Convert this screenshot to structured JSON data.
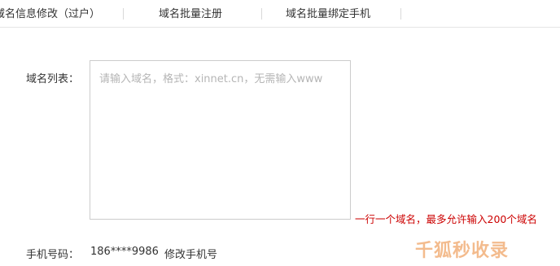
{
  "tabs": [
    {
      "label": "域名信息修改（过户）"
    },
    {
      "label": "域名批量注册"
    },
    {
      "label": "域名批量绑定手机"
    }
  ],
  "form": {
    "domain_list_label": "域名列表：",
    "domain_list_placeholder": "请输入域名，格式：xinnet.cn，无需输入www",
    "domain_list_hint": "一行一个域名，最多允许输入200个域名",
    "phone_label": "手机号码：",
    "phone_value": "186****9986",
    "change_phone_link": "修改手机号"
  },
  "watermark": {
    "text": "千狐秒收录"
  },
  "colors": {
    "hint": "#cc0000",
    "border": "#cccccc",
    "placeholder": "#b5b5b5",
    "watermark": "#f2b07a"
  }
}
